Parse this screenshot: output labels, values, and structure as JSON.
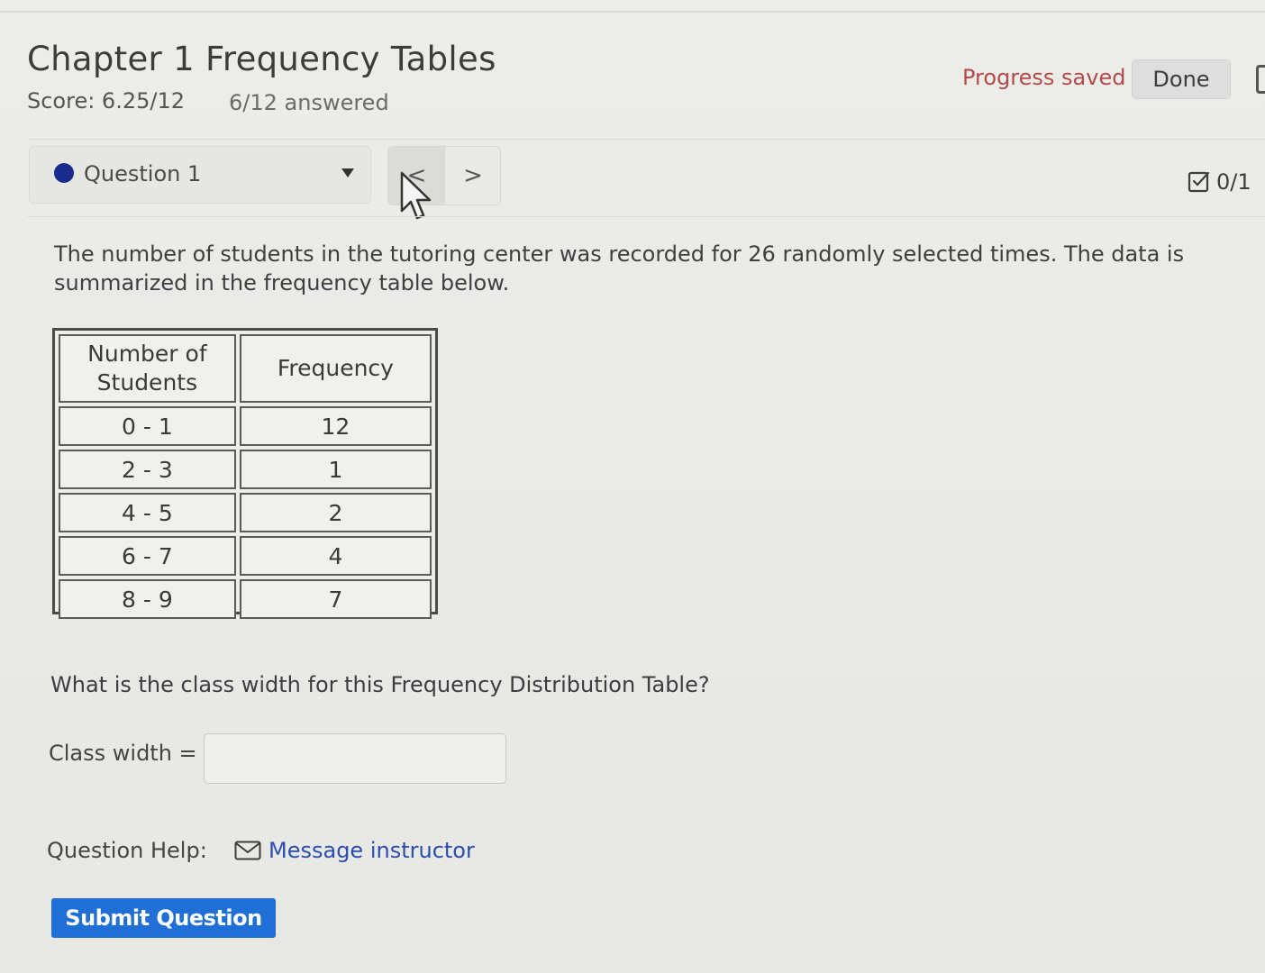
{
  "header": {
    "title": "Chapter 1 Frequency Tables",
    "score": "Score: 6.25/12",
    "answered": "6/12 answered",
    "progress_saved": "Progress saved",
    "done_label": "Done"
  },
  "question_nav": {
    "selected": "Question 1",
    "prev_symbol": "<",
    "next_symbol": ">",
    "points": "0/1",
    "colors": {
      "status_dot": "#1a2d8c"
    }
  },
  "question": {
    "intro": "The number of students in the tutoring center was recorded for 26 randomly selected times. The data is summarized in the frequency table below.",
    "table": {
      "headers": [
        "Number of Students",
        "Frequency"
      ],
      "rows": [
        [
          "0 - 1",
          "12"
        ],
        [
          "2 - 3",
          "1"
        ],
        [
          "4 - 5",
          "2"
        ],
        [
          "6 - 7",
          "4"
        ],
        [
          "8 - 9",
          "7"
        ]
      ]
    },
    "prompt": "What is the class width for this Frequency Distribution Table?",
    "answer_label": "Class width =",
    "answer_value": ""
  },
  "help": {
    "label": "Question Help:",
    "message_link": "Message instructor",
    "icon": "envelope-icon"
  },
  "submit": {
    "label": "Submit Question",
    "color": "#1f6fd6"
  }
}
